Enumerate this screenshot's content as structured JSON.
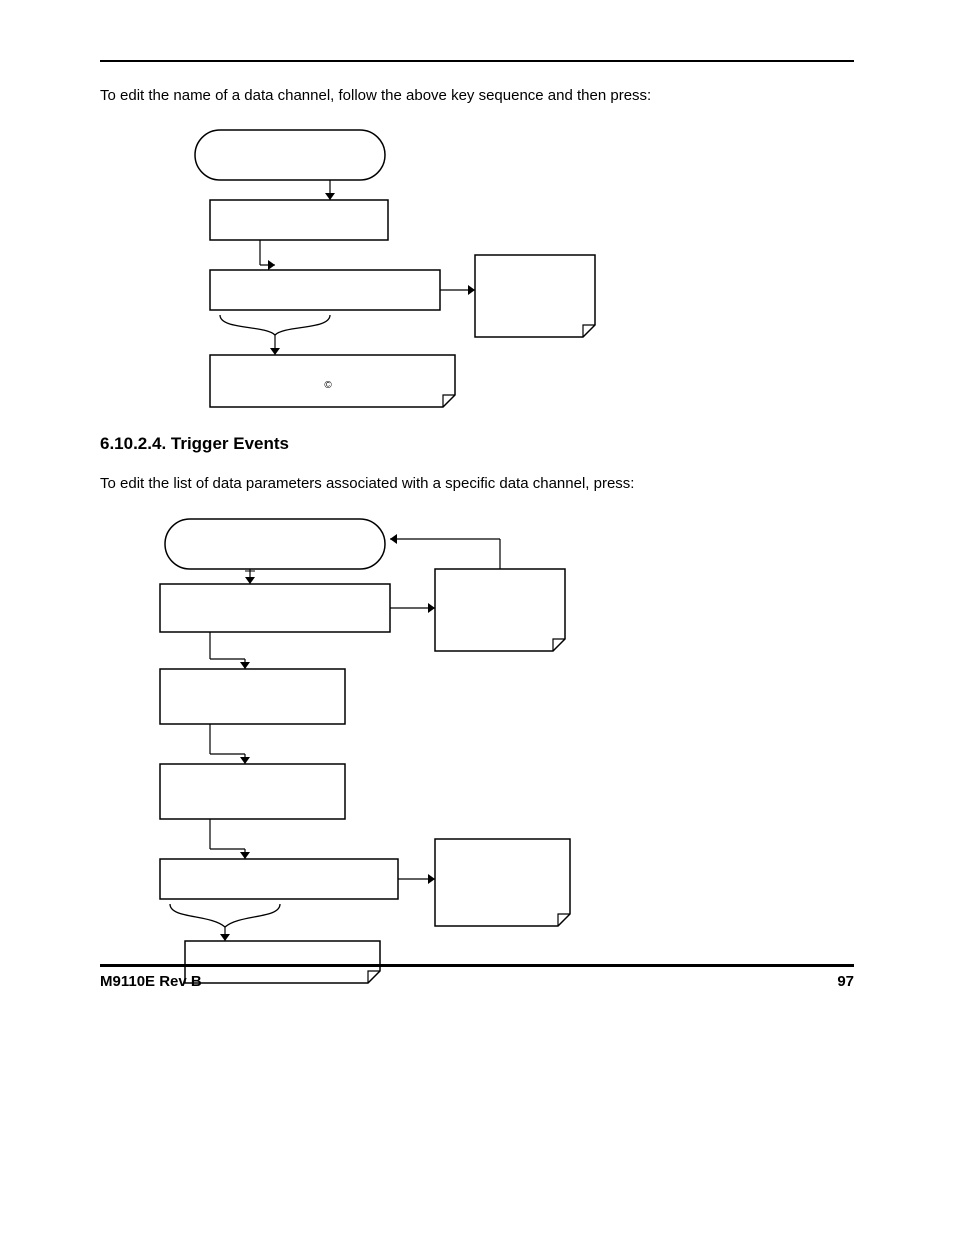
{
  "intro_text_1": "To edit the name of a data channel, follow the above key sequence and then press:",
  "copyright_symbol": "©",
  "heading": "6.10.2.4. Trigger Events",
  "intro_text_2": "To edit the list of data parameters associated with a specific data channel, press:",
  "footer_left": "M9110E Rev B",
  "footer_right": "97"
}
